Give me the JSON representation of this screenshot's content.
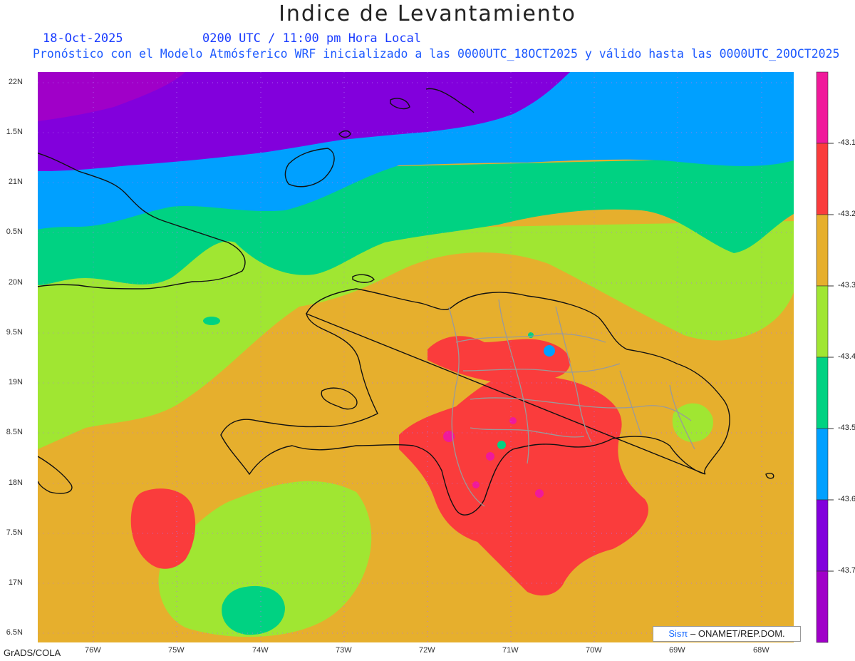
{
  "title": "Indice de Levantamiento",
  "date": "18-Oct-2025",
  "time": "0200 UTC / 11:00 pm Hora Local",
  "subtitle": "Pronóstico con el Modelo Atmósferico WRF inicializado a las 0000UTC_18OCT2025 y válido hasta las  0000UTC_20OCT2025",
  "lat_labels": [
    "22N",
    "1.5N",
    "21N",
    "0.5N",
    "20N",
    "9.5N",
    "19N",
    "8.5N",
    "18N",
    "7.5N",
    "17N",
    "6.5N"
  ],
  "lon_labels": [
    "76W",
    "75W",
    "74W",
    "73W",
    "72W",
    "71W",
    "70W",
    "69W",
    "68W"
  ],
  "colorbar": {
    "labels": [
      "-43.1",
      "-43.2",
      "-43.3",
      "-43.4",
      "-43.5",
      "-43.6",
      "-43.7"
    ],
    "colors": [
      "#f0199b",
      "#fa3c3c",
      "#e6af2d",
      "#a0e632",
      "#00d282",
      "#00a0ff",
      "#8200dc",
      "#a000c8"
    ]
  },
  "footer": "GrADS/COLA",
  "credit_sis": "Sisπ",
  "credit_rest": "– ONAMET/REP.DOM."
}
